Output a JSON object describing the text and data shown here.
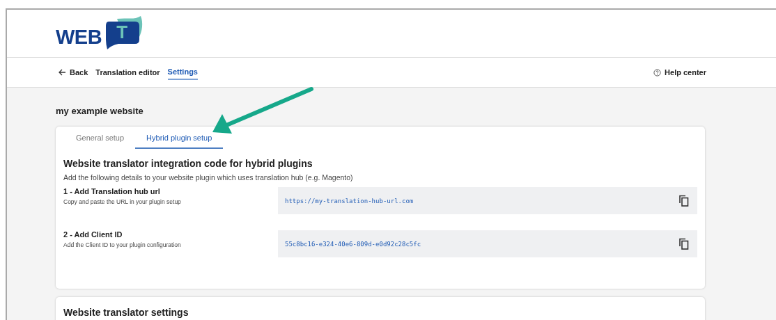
{
  "logo": {
    "text": "WEB",
    "badge": "T"
  },
  "nav": {
    "back": "Back",
    "links": [
      {
        "label": "Translation editor",
        "selected": false
      },
      {
        "label": "Settings",
        "selected": true
      }
    ],
    "help": "Help center"
  },
  "page_title": "my example website",
  "tabs": [
    {
      "label": "General setup",
      "selected": false
    },
    {
      "label": "Hybrid plugin setup",
      "selected": true
    }
  ],
  "section": {
    "title": "Website translator integration code for hybrid plugins",
    "description": "Add the following details to your website plugin which uses translation hub (e.g. Magento)",
    "items": [
      {
        "title": "1 - Add Translation hub url",
        "hint": "Copy and paste the URL in your plugin setup",
        "value": "https://my-translation-hub-url.com"
      },
      {
        "title": "2 - Add Client ID",
        "hint": "Add the Client ID to your plugin configuration",
        "value": "55c8bc16-e324-40e6-809d-e0d92c28c5fc"
      }
    ]
  },
  "next_section": {
    "title": "Website translator settings"
  }
}
